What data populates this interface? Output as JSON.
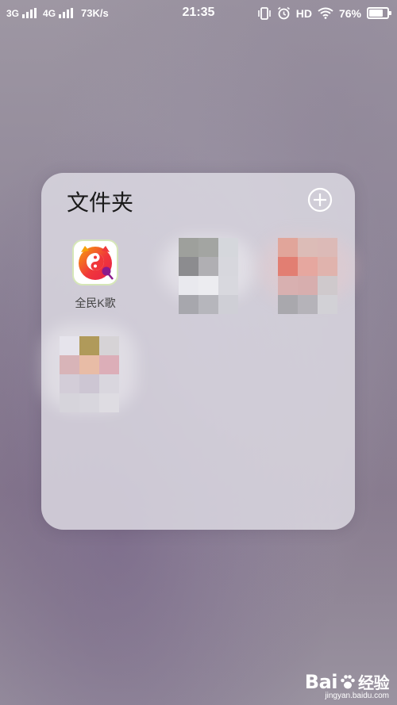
{
  "status_bar": {
    "net1": "3G",
    "net2": "4G",
    "speed": "73K/s",
    "time": "21:35",
    "hd": "HD",
    "battery_text": "76%",
    "battery_level": 0.76
  },
  "folder": {
    "title": "文件夹",
    "apps": [
      {
        "label": "全民K歌",
        "icon": "quanmin-kge-icon"
      }
    ]
  },
  "watermark": {
    "logo": "Bai",
    "logo_tail": "经验",
    "url": "jingyan.baidu.com"
  },
  "colors": {
    "kge_red": "#f0373a",
    "kge_orange": "#f7a20b",
    "kge_purple": "#8b1a8c"
  }
}
